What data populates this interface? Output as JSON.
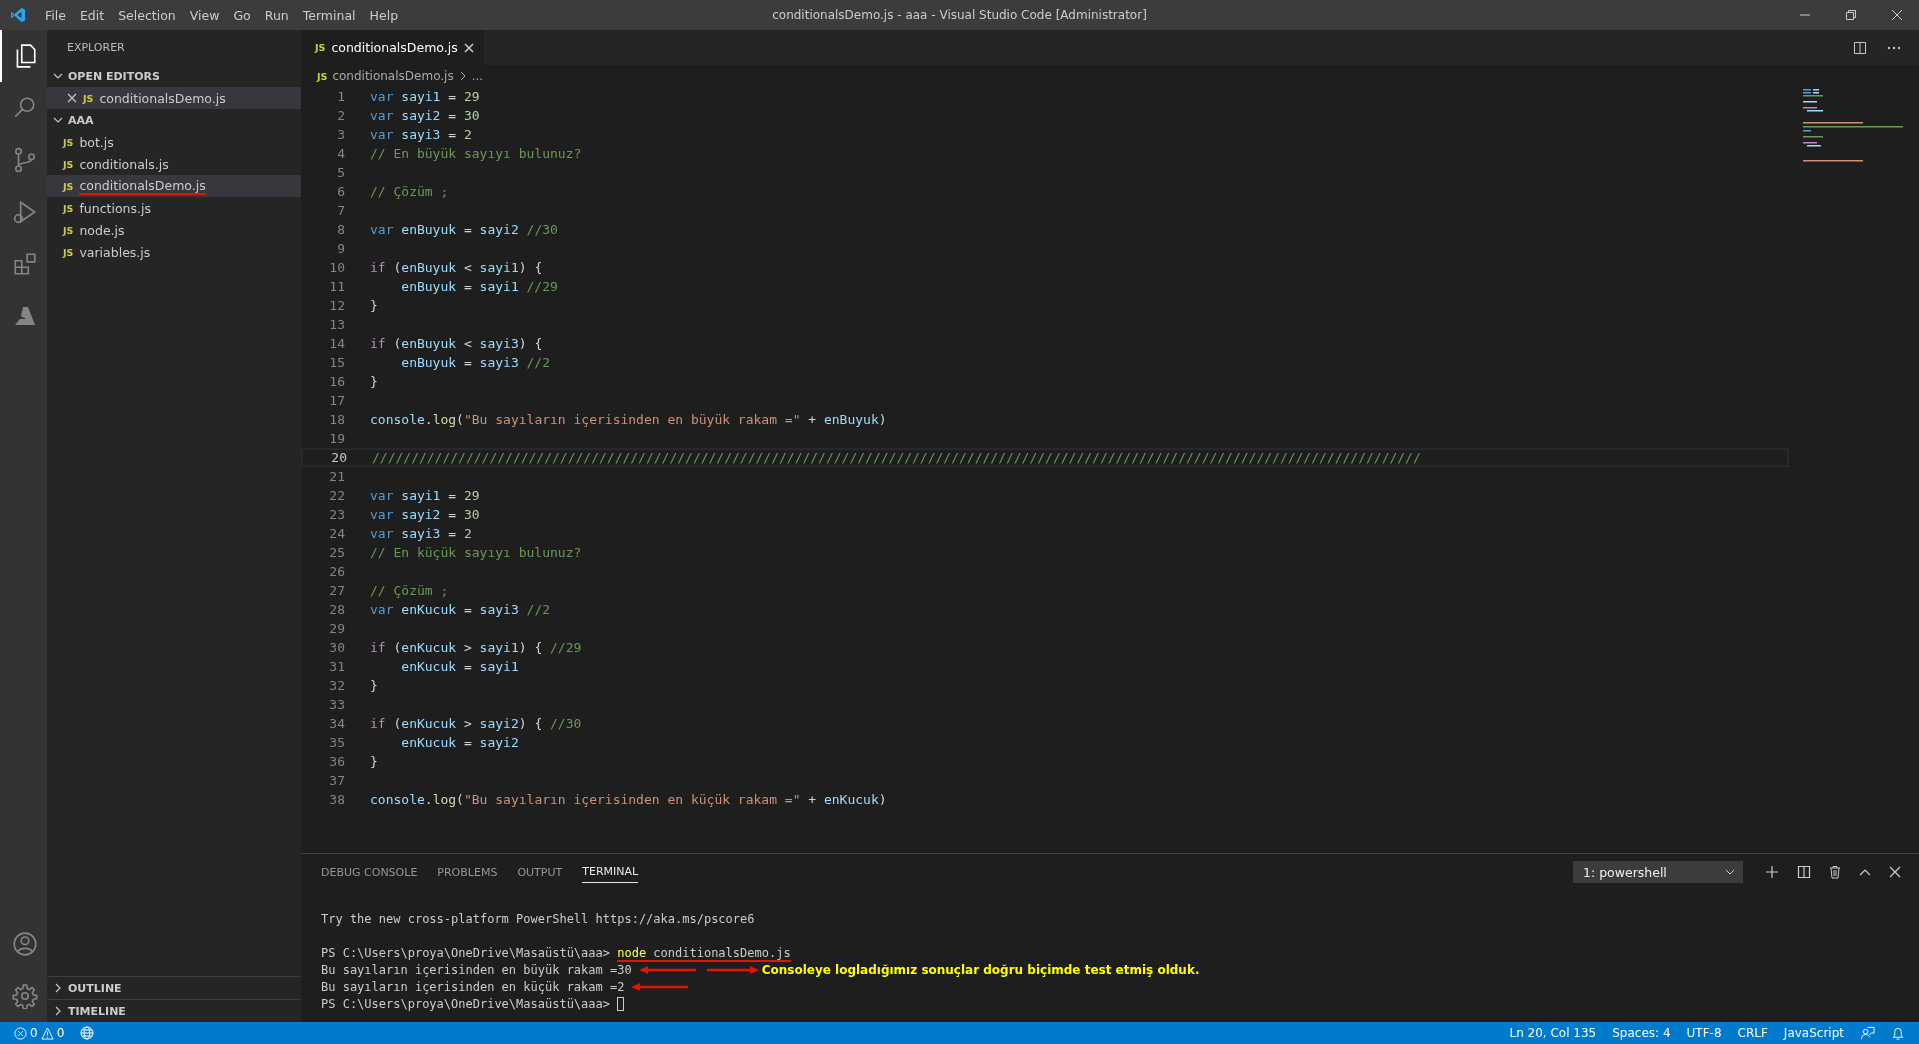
{
  "title_bar": {
    "menu": [
      "File",
      "Edit",
      "Selection",
      "View",
      "Go",
      "Run",
      "Terminal",
      "Help"
    ],
    "title": "conditionalsDemo.js - aaa - Visual Studio Code [Administrator]"
  },
  "activity_bar": {
    "top": [
      {
        "kind": "files",
        "selected": true
      },
      {
        "kind": "search",
        "selected": false
      },
      {
        "kind": "source",
        "selected": false
      },
      {
        "kind": "debug",
        "selected": false
      },
      {
        "kind": "extensions",
        "selected": false
      },
      {
        "kind": "azure",
        "selected": false
      }
    ],
    "bottom": [
      {
        "kind": "account"
      },
      {
        "kind": "settings"
      }
    ]
  },
  "sidebar": {
    "title": "EXPLORER",
    "open_editors": {
      "label": "OPEN EDITORS",
      "expanded": true,
      "items": [
        {
          "file_type": "JS",
          "name": "conditionalsDemo.js",
          "selected": true
        }
      ]
    },
    "folder": {
      "label": "AAA",
      "expanded": true,
      "items": [
        {
          "file_type": "JS",
          "name": "bot.js",
          "selected": false,
          "underlined": false
        },
        {
          "file_type": "JS",
          "name": "conditionals.js",
          "selected": false,
          "underlined": false
        },
        {
          "file_type": "JS",
          "name": "conditionalsDemo.js",
          "selected": true,
          "underlined": true
        },
        {
          "file_type": "JS",
          "name": "functions.js",
          "selected": false,
          "underlined": false
        },
        {
          "file_type": "JS",
          "name": "node.js",
          "selected": false,
          "underlined": false
        },
        {
          "file_type": "JS",
          "name": "variables.js",
          "selected": false,
          "underlined": false
        }
      ]
    },
    "sections": [
      {
        "label": "OUTLINE",
        "expanded": false
      },
      {
        "label": "TIMELINE",
        "expanded": false
      }
    ]
  },
  "editor": {
    "tabs": [
      {
        "file_type": "JS",
        "label": "conditionalsDemo.js",
        "selected": true
      }
    ],
    "breadcrumb": {
      "file_type": "JS",
      "file": "conditionalsDemo.js",
      "more": "..."
    },
    "lines": [
      {
        "number": "1",
        "current": false,
        "tokens": [
          {
            "kind": "kw",
            "text": "var "
          },
          {
            "kind": "id",
            "text": "sayi1"
          },
          {
            "kind": "p",
            "text": " = "
          },
          {
            "kind": "num",
            "text": "29"
          }
        ]
      },
      {
        "number": "2",
        "current": false,
        "tokens": [
          {
            "kind": "kw",
            "text": "var "
          },
          {
            "kind": "id",
            "text": "sayi2"
          },
          {
            "kind": "p",
            "text": " = "
          },
          {
            "kind": "num",
            "text": "30"
          }
        ]
      },
      {
        "number": "3",
        "current": false,
        "tokens": [
          {
            "kind": "kw",
            "text": "var "
          },
          {
            "kind": "id",
            "text": "sayi3"
          },
          {
            "kind": "p",
            "text": " = "
          },
          {
            "kind": "num",
            "text": "2"
          }
        ]
      },
      {
        "number": "4",
        "current": false,
        "tokens": [
          {
            "kind": "com",
            "text": "// En büyük sayıyı bulunuz?"
          }
        ]
      },
      {
        "number": "5",
        "current": false
      },
      {
        "number": "6",
        "current": false,
        "tokens": [
          {
            "kind": "com",
            "text": "// Çözüm ;"
          }
        ]
      },
      {
        "number": "7",
        "current": false
      },
      {
        "number": "8",
        "current": false,
        "tokens": [
          {
            "kind": "kw",
            "text": "var "
          },
          {
            "kind": "id",
            "text": "enBuyuk"
          },
          {
            "kind": "p",
            "text": " = "
          },
          {
            "kind": "id",
            "text": "sayi2"
          },
          {
            "kind": "com",
            "text": " //30"
          }
        ]
      },
      {
        "number": "9",
        "current": false
      },
      {
        "number": "10",
        "current": false,
        "tokens": [
          {
            "kind": "ctl",
            "text": "if"
          },
          {
            "kind": "p",
            "text": " ("
          },
          {
            "kind": "id",
            "text": "enBuyuk"
          },
          {
            "kind": "p",
            "text": " < "
          },
          {
            "kind": "id",
            "text": "sayi1"
          },
          {
            "kind": "p",
            "text": ") {"
          }
        ]
      },
      {
        "number": "11",
        "current": false,
        "tokens": [
          {
            "kind": "id",
            "text": "    enBuyuk"
          },
          {
            "kind": "p",
            "text": " = "
          },
          {
            "kind": "id",
            "text": "sayi1"
          },
          {
            "kind": "com",
            "text": " //29"
          }
        ]
      },
      {
        "number": "12",
        "current": false,
        "tokens": [
          {
            "kind": "p",
            "text": "}"
          }
        ]
      },
      {
        "number": "13",
        "current": false
      },
      {
        "number": "14",
        "current": false,
        "tokens": [
          {
            "kind": "ctl",
            "text": "if"
          },
          {
            "kind": "p",
            "text": " ("
          },
          {
            "kind": "id",
            "text": "enBuyuk"
          },
          {
            "kind": "p",
            "text": " < "
          },
          {
            "kind": "id",
            "text": "sayi3"
          },
          {
            "kind": "p",
            "text": ") {"
          }
        ]
      },
      {
        "number": "15",
        "current": false,
        "tokens": [
          {
            "kind": "id",
            "text": "    enBuyuk"
          },
          {
            "kind": "p",
            "text": " = "
          },
          {
            "kind": "id",
            "text": "sayi3"
          },
          {
            "kind": "com",
            "text": " //2"
          }
        ]
      },
      {
        "number": "16",
        "current": false,
        "tokens": [
          {
            "kind": "p",
            "text": "}"
          }
        ]
      },
      {
        "number": "17",
        "current": false
      },
      {
        "number": "18",
        "current": false,
        "tokens": [
          {
            "kind": "id",
            "text": "console"
          },
          {
            "kind": "p",
            "text": "."
          },
          {
            "kind": "fn",
            "text": "log"
          },
          {
            "kind": "p",
            "text": "("
          },
          {
            "kind": "str",
            "text": "\"Bu sayıların içerisinden en büyük rakam =\""
          },
          {
            "kind": "p",
            "text": " + "
          },
          {
            "kind": "id",
            "text": "enBuyuk"
          },
          {
            "kind": "p",
            "text": ")"
          }
        ]
      },
      {
        "number": "19",
        "current": false
      },
      {
        "number": "20",
        "current": true,
        "tokens": [
          {
            "kind": "com",
            "text": "//////////////////////////////////////////////////////////////////////////////////////////////////////////////////////////////////////"
          }
        ]
      },
      {
        "number": "21",
        "current": false
      },
      {
        "number": "22",
        "current": false,
        "tokens": [
          {
            "kind": "kw",
            "text": "var "
          },
          {
            "kind": "id",
            "text": "sayi1"
          },
          {
            "kind": "p",
            "text": " = "
          },
          {
            "kind": "num",
            "text": "29"
          }
        ]
      },
      {
        "number": "23",
        "current": false,
        "tokens": [
          {
            "kind": "kw",
            "text": "var "
          },
          {
            "kind": "id",
            "text": "sayi2"
          },
          {
            "kind": "p",
            "text": " = "
          },
          {
            "kind": "num",
            "text": "30"
          }
        ]
      },
      {
        "number": "24",
        "current": false,
        "tokens": [
          {
            "kind": "kw",
            "text": "var "
          },
          {
            "kind": "id",
            "text": "sayi3"
          },
          {
            "kind": "p",
            "text": " = "
          },
          {
            "kind": "num",
            "text": "2"
          }
        ]
      },
      {
        "number": "25",
        "current": false,
        "tokens": [
          {
            "kind": "com",
            "text": "// En küçük sayıyı bulunuz?"
          }
        ]
      },
      {
        "number": "26",
        "current": false
      },
      {
        "number": "27",
        "current": false,
        "tokens": [
          {
            "kind": "com",
            "text": "// Çözüm ;"
          }
        ]
      },
      {
        "number": "28",
        "current": false,
        "tokens": [
          {
            "kind": "kw",
            "text": "var "
          },
          {
            "kind": "id",
            "text": "enKucuk"
          },
          {
            "kind": "p",
            "text": " = "
          },
          {
            "kind": "id",
            "text": "sayi3"
          },
          {
            "kind": "com",
            "text": " //2"
          }
        ]
      },
      {
        "number": "29",
        "current": false
      },
      {
        "number": "30",
        "current": false,
        "tokens": [
          {
            "kind": "ctl",
            "text": "if"
          },
          {
            "kind": "p",
            "text": " ("
          },
          {
            "kind": "id",
            "text": "enKucuk"
          },
          {
            "kind": "p",
            "text": " > "
          },
          {
            "kind": "id",
            "text": "sayi1"
          },
          {
            "kind": "p",
            "text": ") { "
          },
          {
            "kind": "com",
            "text": "//29"
          }
        ]
      },
      {
        "number": "31",
        "current": false,
        "tokens": [
          {
            "kind": "id",
            "text": "    enKucuk"
          },
          {
            "kind": "p",
            "text": " = "
          },
          {
            "kind": "id",
            "text": "sayi1"
          }
        ]
      },
      {
        "number": "32",
        "current": false,
        "tokens": [
          {
            "kind": "p",
            "text": "}"
          }
        ]
      },
      {
        "number": "33",
        "current": false
      },
      {
        "number": "34",
        "current": false,
        "tokens": [
          {
            "kind": "ctl",
            "text": "if"
          },
          {
            "kind": "p",
            "text": " ("
          },
          {
            "kind": "id",
            "text": "enKucuk"
          },
          {
            "kind": "p",
            "text": " > "
          },
          {
            "kind": "id",
            "text": "sayi2"
          },
          {
            "kind": "p",
            "text": ") { "
          },
          {
            "kind": "com",
            "text": "//30"
          }
        ]
      },
      {
        "number": "35",
        "current": false,
        "tokens": [
          {
            "kind": "id",
            "text": "    enKucuk"
          },
          {
            "kind": "p",
            "text": " = "
          },
          {
            "kind": "id",
            "text": "sayi2"
          }
        ]
      },
      {
        "number": "36",
        "current": false,
        "tokens": [
          {
            "kind": "p",
            "text": "}"
          }
        ]
      },
      {
        "number": "37",
        "current": false
      },
      {
        "number": "38",
        "current": false,
        "tokens": [
          {
            "kind": "id",
            "text": "console"
          },
          {
            "kind": "p",
            "text": "."
          },
          {
            "kind": "fn",
            "text": "log"
          },
          {
            "kind": "p",
            "text": "("
          },
          {
            "kind": "str",
            "text": "\"Bu sayıların içerisinden en küçük rakam =\""
          },
          {
            "kind": "p",
            "text": " + "
          },
          {
            "kind": "id",
            "text": "enKucuk"
          },
          {
            "kind": "p",
            "text": ")"
          }
        ]
      }
    ]
  },
  "panel": {
    "tabs": [
      {
        "label": "DEBUG CONSOLE",
        "selected": false
      },
      {
        "label": "PROBLEMS",
        "selected": false
      },
      {
        "label": "OUTPUT",
        "selected": false
      },
      {
        "label": "TERMINAL",
        "selected": true
      }
    ],
    "terminal_select": "1: powershell",
    "terminal_lines": [
      {
        "cursor": false,
        "arrow": false,
        "segments": [
          {
            "kind": "plain",
            "text": "Try the new cross-platform PowerShell https://aka.ms/pscore6",
            "underlined": false
          }
        ]
      },
      {
        "cursor": false,
        "arrow": false
      },
      {
        "cursor": false,
        "arrow": false,
        "segments": [
          {
            "kind": "plain",
            "text": "PS C:\\Users\\proya\\OneDrive\\Masaüstü\\aaa> ",
            "underlined": false
          },
          {
            "kind": "command",
            "text": "node",
            "underlined": true
          },
          {
            "kind": "plain",
            "text": " conditionalsDemo.js",
            "underlined": true
          }
        ]
      },
      {
        "cursor": false,
        "arrow": true,
        "note": "Consoleye logladığımız sonuçlar doğru biçimde test etmiş olduk.",
        "segments": [
          {
            "kind": "plain",
            "text": "Bu sayıların içerisinden en büyük rakam =30",
            "underlined": false
          }
        ]
      },
      {
        "cursor": false,
        "arrow": true,
        "segments": [
          {
            "kind": "plain",
            "text": "Bu sayıların içerisinden en küçük rakam =2",
            "underlined": false
          }
        ]
      },
      {
        "cursor": true,
        "arrow": false,
        "segments": [
          {
            "kind": "plain",
            "text": "PS C:\\Users\\proya\\OneDrive\\Masaüstü\\aaa> ",
            "underlined": false
          }
        ]
      }
    ]
  },
  "status_bar": {
    "errors": "0",
    "warnings": "0",
    "right": [
      "Ln 20, Col 135",
      "Spaces: 4",
      "UTF-8",
      "CRLF",
      "JavaScript"
    ]
  }
}
